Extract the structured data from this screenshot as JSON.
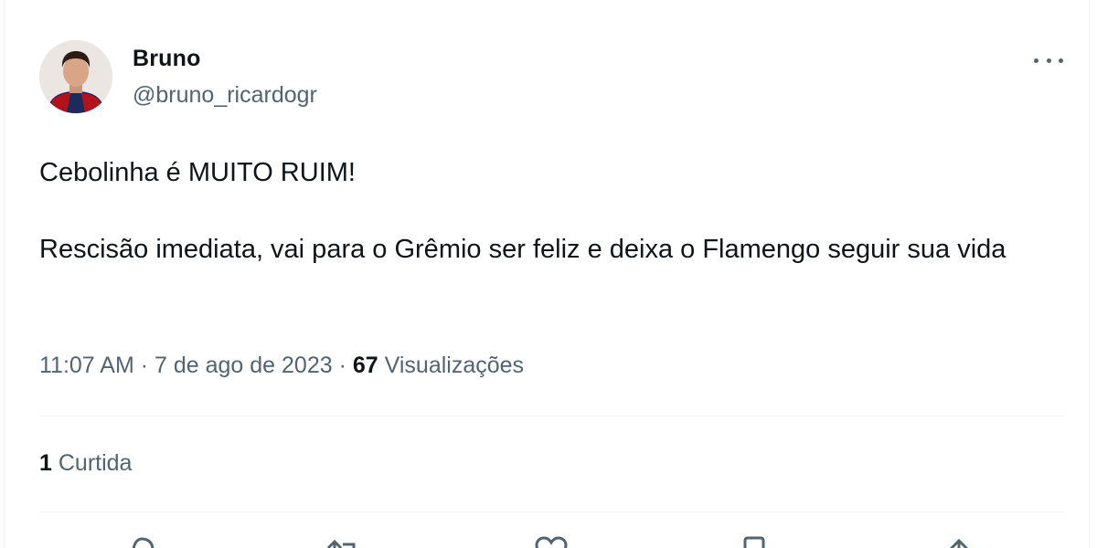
{
  "tweet": {
    "author": {
      "display_name": "Bruno",
      "handle": "@bruno_ricardogr"
    },
    "text": {
      "line1": "Cebolinha é MUITO RUIM!",
      "line2": "Rescisão imediata, vai para o Grêmio ser feliz e deixa o Flamengo seguir sua vida"
    },
    "meta": {
      "time": "11:07 AM",
      "separator": "·",
      "date": "7 de ago de 2023",
      "views_count": "67",
      "views_label": "Visualizações"
    },
    "likes": {
      "count": "1",
      "label": "Curtida"
    },
    "actions": [
      "reply-icon",
      "retweet-icon",
      "like-icon",
      "bookmark-icon",
      "share-icon"
    ]
  },
  "colors": {
    "text_primary": "#0f1419",
    "text_secondary": "#536471",
    "divider": "#eff3f4"
  }
}
